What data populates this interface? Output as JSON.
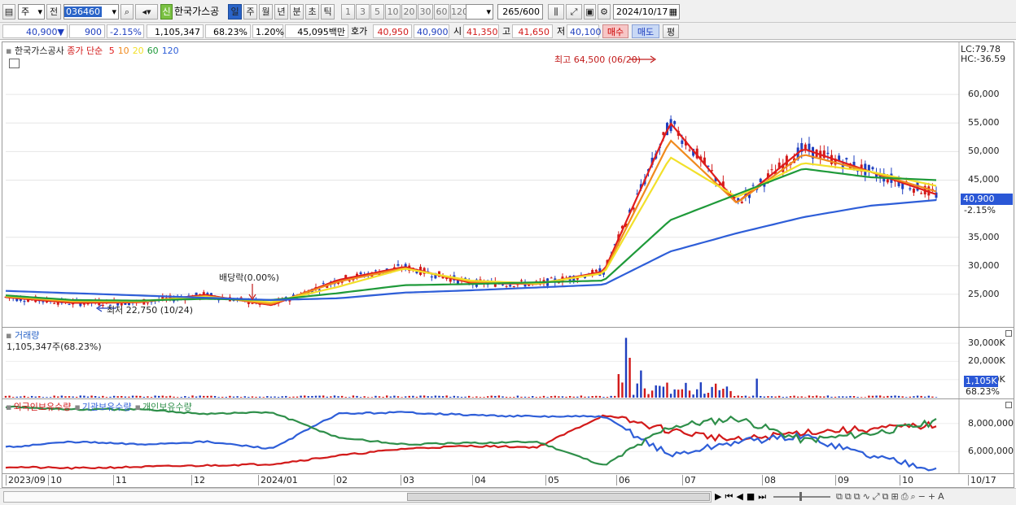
{
  "toolbar": {
    "type_select": "주",
    "prev_label": "전",
    "code": "036460",
    "name": "한국가스공",
    "credit_badge": "신",
    "periods": [
      "일",
      "주",
      "월",
      "년",
      "분",
      "초",
      "틱"
    ],
    "active_period": "일",
    "intervals": [
      "1",
      "3",
      "5",
      "10",
      "20",
      "30",
      "60",
      "120"
    ],
    "count": "265",
    "count_max": "/600",
    "date": "2024/10/17"
  },
  "quote": {
    "price": "40,900",
    "direction": "▼",
    "change": "900",
    "change_pct": "-2.15%",
    "volume": "1,105,347",
    "vol_ratio": "68.23%",
    "turnover": "1.20%",
    "amount": "45,095백만",
    "hoga_label": "호가",
    "ask": "40,950",
    "bid": "40,900",
    "open_label": "시",
    "open": "41,350",
    "high_label": "고",
    "high": "41,650",
    "low_label": "저",
    "low": "40,100",
    "buy_label": "매수",
    "sell_label": "매도",
    "eval_label": "평"
  },
  "price_panel": {
    "name": "한국가스공사",
    "ma_label": "종가 단순",
    "ma_periods": [
      "5",
      "10",
      "20",
      "60",
      "120"
    ],
    "ma_colors": [
      "#e01c1c",
      "#f08a1e",
      "#f2e02a",
      "#1f9a3a",
      "#2e5ed8",
      "#3a7fd8"
    ],
    "lc": "LC:79.78",
    "hc": "HC:-36.59",
    "y_ticks": [
      "60,000",
      "55,000",
      "50,000",
      "45,000",
      "40,900",
      "35,000",
      "30,000",
      "25,000"
    ],
    "price_tag": "40,900",
    "pct_tag": "-2.15%",
    "high_annot": "최고 64,500 (06/20)",
    "low_annot": "최저 22,750 (10/24)",
    "div_annot": "배당락(0.00%)"
  },
  "volume_panel": {
    "title": "거래량",
    "value": "1,105,347주(68.23%)",
    "y_ticks": [
      "30,000K",
      "20,000K",
      "10,000K"
    ],
    "vol_tag": "1,105K",
    "pct_tag": "68.23%"
  },
  "holding_panel": {
    "items": [
      "외국인보유수량",
      "기관보유수량",
      "개인보유수량"
    ],
    "colors": [
      "#d21a1a",
      "#2e5ed8",
      "#2f8f4a"
    ],
    "y_ticks": [
      "8,000,000",
      "6,000,000"
    ]
  },
  "x_axis": {
    "labels": [
      "2023/09",
      "10",
      "11",
      "12",
      "2024/01",
      "02",
      "03",
      "04",
      "05",
      "06",
      "07",
      "08",
      "09",
      "10",
      "10/17"
    ]
  },
  "chart_data": {
    "type": "line",
    "title": "한국가스공사",
    "x": [
      "2023/09",
      "10",
      "11",
      "12",
      "2024/01",
      "02",
      "03",
      "04",
      "05",
      "06",
      "07",
      "08",
      "09",
      "10",
      "10/17"
    ],
    "ylim": [
      21000,
      66000
    ],
    "series": [
      {
        "name": "5",
        "values": [
          24500,
          23500,
          23600,
          24900,
          23100,
          27500,
          29800,
          27000,
          26800,
          29000,
          55000,
          41000,
          50500,
          46500,
          42500
        ]
      },
      {
        "name": "10",
        "values": [
          24600,
          23700,
          23700,
          24700,
          23300,
          27200,
          29600,
          27200,
          26800,
          28800,
          52000,
          41000,
          49500,
          46500,
          43000
        ]
      },
      {
        "name": "20",
        "values": [
          24700,
          23900,
          23800,
          24600,
          23600,
          26300,
          29500,
          27400,
          26900,
          28700,
          49000,
          42000,
          48000,
          46500,
          44000
        ]
      },
      {
        "name": "60",
        "values": [
          24800,
          24000,
          23900,
          24200,
          24000,
          25200,
          26600,
          26800,
          27100,
          27400,
          38000,
          42500,
          47000,
          45500,
          45000
        ]
      },
      {
        "name": "120",
        "values": [
          25600,
          25200,
          24800,
          24400,
          24000,
          24300,
          25300,
          25700,
          26200,
          26700,
          32500,
          35700,
          38500,
          40500,
          41500
        ]
      }
    ]
  }
}
